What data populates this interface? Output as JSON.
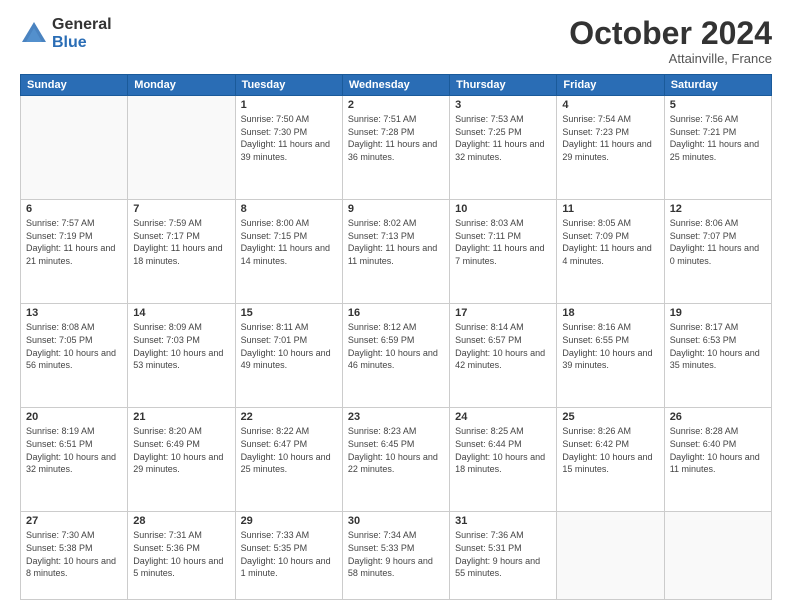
{
  "logo": {
    "general": "General",
    "blue": "Blue"
  },
  "header": {
    "month": "October 2024",
    "location": "Attainville, France"
  },
  "weekdays": [
    "Sunday",
    "Monday",
    "Tuesday",
    "Wednesday",
    "Thursday",
    "Friday",
    "Saturday"
  ],
  "weeks": [
    [
      {
        "day": "",
        "detail": ""
      },
      {
        "day": "",
        "detail": ""
      },
      {
        "day": "1",
        "detail": "Sunrise: 7:50 AM\nSunset: 7:30 PM\nDaylight: 11 hours and 39 minutes."
      },
      {
        "day": "2",
        "detail": "Sunrise: 7:51 AM\nSunset: 7:28 PM\nDaylight: 11 hours and 36 minutes."
      },
      {
        "day": "3",
        "detail": "Sunrise: 7:53 AM\nSunset: 7:25 PM\nDaylight: 11 hours and 32 minutes."
      },
      {
        "day": "4",
        "detail": "Sunrise: 7:54 AM\nSunset: 7:23 PM\nDaylight: 11 hours and 29 minutes."
      },
      {
        "day": "5",
        "detail": "Sunrise: 7:56 AM\nSunset: 7:21 PM\nDaylight: 11 hours and 25 minutes."
      }
    ],
    [
      {
        "day": "6",
        "detail": "Sunrise: 7:57 AM\nSunset: 7:19 PM\nDaylight: 11 hours and 21 minutes."
      },
      {
        "day": "7",
        "detail": "Sunrise: 7:59 AM\nSunset: 7:17 PM\nDaylight: 11 hours and 18 minutes."
      },
      {
        "day": "8",
        "detail": "Sunrise: 8:00 AM\nSunset: 7:15 PM\nDaylight: 11 hours and 14 minutes."
      },
      {
        "day": "9",
        "detail": "Sunrise: 8:02 AM\nSunset: 7:13 PM\nDaylight: 11 hours and 11 minutes."
      },
      {
        "day": "10",
        "detail": "Sunrise: 8:03 AM\nSunset: 7:11 PM\nDaylight: 11 hours and 7 minutes."
      },
      {
        "day": "11",
        "detail": "Sunrise: 8:05 AM\nSunset: 7:09 PM\nDaylight: 11 hours and 4 minutes."
      },
      {
        "day": "12",
        "detail": "Sunrise: 8:06 AM\nSunset: 7:07 PM\nDaylight: 11 hours and 0 minutes."
      }
    ],
    [
      {
        "day": "13",
        "detail": "Sunrise: 8:08 AM\nSunset: 7:05 PM\nDaylight: 10 hours and 56 minutes."
      },
      {
        "day": "14",
        "detail": "Sunrise: 8:09 AM\nSunset: 7:03 PM\nDaylight: 10 hours and 53 minutes."
      },
      {
        "day": "15",
        "detail": "Sunrise: 8:11 AM\nSunset: 7:01 PM\nDaylight: 10 hours and 49 minutes."
      },
      {
        "day": "16",
        "detail": "Sunrise: 8:12 AM\nSunset: 6:59 PM\nDaylight: 10 hours and 46 minutes."
      },
      {
        "day": "17",
        "detail": "Sunrise: 8:14 AM\nSunset: 6:57 PM\nDaylight: 10 hours and 42 minutes."
      },
      {
        "day": "18",
        "detail": "Sunrise: 8:16 AM\nSunset: 6:55 PM\nDaylight: 10 hours and 39 minutes."
      },
      {
        "day": "19",
        "detail": "Sunrise: 8:17 AM\nSunset: 6:53 PM\nDaylight: 10 hours and 35 minutes."
      }
    ],
    [
      {
        "day": "20",
        "detail": "Sunrise: 8:19 AM\nSunset: 6:51 PM\nDaylight: 10 hours and 32 minutes."
      },
      {
        "day": "21",
        "detail": "Sunrise: 8:20 AM\nSunset: 6:49 PM\nDaylight: 10 hours and 29 minutes."
      },
      {
        "day": "22",
        "detail": "Sunrise: 8:22 AM\nSunset: 6:47 PM\nDaylight: 10 hours and 25 minutes."
      },
      {
        "day": "23",
        "detail": "Sunrise: 8:23 AM\nSunset: 6:45 PM\nDaylight: 10 hours and 22 minutes."
      },
      {
        "day": "24",
        "detail": "Sunrise: 8:25 AM\nSunset: 6:44 PM\nDaylight: 10 hours and 18 minutes."
      },
      {
        "day": "25",
        "detail": "Sunrise: 8:26 AM\nSunset: 6:42 PM\nDaylight: 10 hours and 15 minutes."
      },
      {
        "day": "26",
        "detail": "Sunrise: 8:28 AM\nSunset: 6:40 PM\nDaylight: 10 hours and 11 minutes."
      }
    ],
    [
      {
        "day": "27",
        "detail": "Sunrise: 7:30 AM\nSunset: 5:38 PM\nDaylight: 10 hours and 8 minutes."
      },
      {
        "day": "28",
        "detail": "Sunrise: 7:31 AM\nSunset: 5:36 PM\nDaylight: 10 hours and 5 minutes."
      },
      {
        "day": "29",
        "detail": "Sunrise: 7:33 AM\nSunset: 5:35 PM\nDaylight: 10 hours and 1 minute."
      },
      {
        "day": "30",
        "detail": "Sunrise: 7:34 AM\nSunset: 5:33 PM\nDaylight: 9 hours and 58 minutes."
      },
      {
        "day": "31",
        "detail": "Sunrise: 7:36 AM\nSunset: 5:31 PM\nDaylight: 9 hours and 55 minutes."
      },
      {
        "day": "",
        "detail": ""
      },
      {
        "day": "",
        "detail": ""
      }
    ]
  ]
}
